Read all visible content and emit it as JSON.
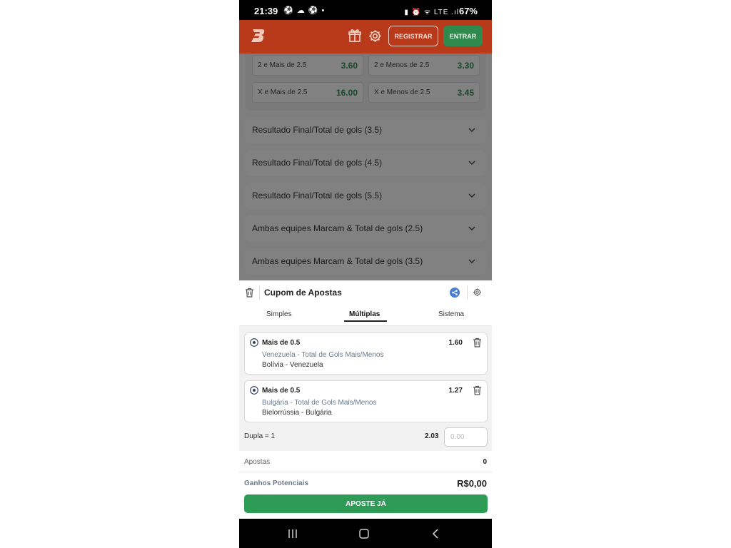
{
  "status_bar": {
    "time": "21:39",
    "left_icons": "⚽ ☁ ⚽ •",
    "right_icons": "▮ ⏰ ᯤ LTE .ıl",
    "battery": "67%"
  },
  "header": {
    "register_label": "REGISTRAR",
    "login_label": "ENTRAR"
  },
  "odds": [
    {
      "label": "2 e Mais de 2.5",
      "value": "3.60"
    },
    {
      "label": "2 e Menos de 2.5",
      "value": "3.30"
    },
    {
      "label": "X e Mais de 2.5",
      "value": "16.00"
    },
    {
      "label": "X e Menos de 2.5",
      "value": "3.45"
    }
  ],
  "markets": [
    "Resultado Final/Total de gols (3.5)",
    "Resultado Final/Total de gols (4.5)",
    "Resultado Final/Total de gols (5.5)",
    "Ambas equipes Marcam & Total de gols (2.5)",
    "Ambas equipes Marcam & Total de gols (3.5)"
  ],
  "bet_slip": {
    "title": "Cupom de Apostas",
    "tabs": [
      "Simples",
      "Múltiplas",
      "Sistema"
    ],
    "active_tab": "Múltiplas",
    "bets": [
      {
        "selection": "Mais de 0.5",
        "market": "Venezuela - Total de Gols Mais/Menos",
        "event": "Bolívia - Venezuela",
        "odd": "1.60"
      },
      {
        "selection": "Mais de 0.5",
        "market": "Bulgária - Total de Gols Mais/Menos",
        "event": "Bielorrússia - Bulgária",
        "odd": "1.27"
      }
    ],
    "combo_label": "Dupla = 1",
    "combo_odd": "2.03",
    "stake_placeholder": "0.00",
    "bets_label": "Apostas",
    "bets_count": "0",
    "potential_label": "Ganhos Potenciais",
    "potential_value": "R$0,00",
    "cta_label": "APOSTE JÁ"
  },
  "colors": {
    "brand": "#b83a1a",
    "accent_green": "#2e9b57",
    "odd_green": "#2e8b4d"
  }
}
